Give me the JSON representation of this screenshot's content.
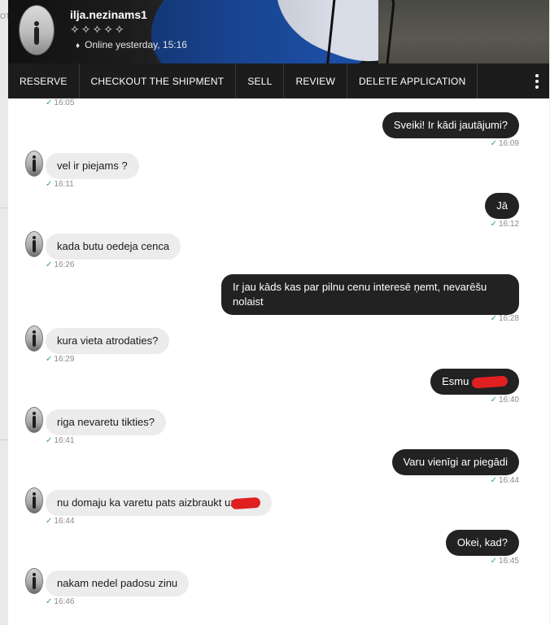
{
  "background_text": "OT",
  "header": {
    "username": "ilja.nezinams1",
    "rating_stars": "✧✧✧✧✧",
    "status": "Online yesterday, 15:16"
  },
  "toolbar": {
    "reserve": "RESERVE",
    "checkout": "CHECKOUT THE SHIPMENT",
    "sell": "SELL",
    "review": "REVIEW",
    "delete": "DELETE APPLICATION",
    "more_icon": "vertical-ellipsis-icon"
  },
  "messages": [
    {
      "from": "them",
      "text": "",
      "time": "16:05"
    },
    {
      "from": "me",
      "text": "Sveiki! Ir kādi jautājumi?",
      "time": "16:09"
    },
    {
      "from": "them",
      "text": "vel ir piejams ?",
      "time": "16:11"
    },
    {
      "from": "me",
      "text": "Jā",
      "time": "16:12"
    },
    {
      "from": "them",
      "text": "kada butu oedeja cenca",
      "time": "16:26"
    },
    {
      "from": "me",
      "text": "Ir jau kāds kas par pilnu cenu interesē ņemt, nevarēšu nolaist",
      "time": "16:28"
    },
    {
      "from": "them",
      "text": "kura vieta atrodaties?",
      "time": "16:29"
    },
    {
      "from": "me",
      "text": "Esmu",
      "time": "16:40",
      "redacted": true
    },
    {
      "from": "them",
      "text": "riga nevaretu tikties?",
      "time": "16:41"
    },
    {
      "from": "me",
      "text": "Varu vienīgi ar piegādi",
      "time": "16:44"
    },
    {
      "from": "them",
      "text": "nu domaju ka varetu pats aizbraukt uz",
      "time": "16:44",
      "redacted": true
    },
    {
      "from": "me",
      "text": "Okei, kad?",
      "time": "16:45"
    },
    {
      "from": "them",
      "text": "nakam nedel padosu zinu",
      "time": "16:46"
    }
  ],
  "colors": {
    "toolbar_bg": "#1c1c1c",
    "outgoing_bubble": "#222222",
    "incoming_bubble": "#ececec",
    "read_check": "#3aa56a",
    "redaction": "#e02020"
  }
}
